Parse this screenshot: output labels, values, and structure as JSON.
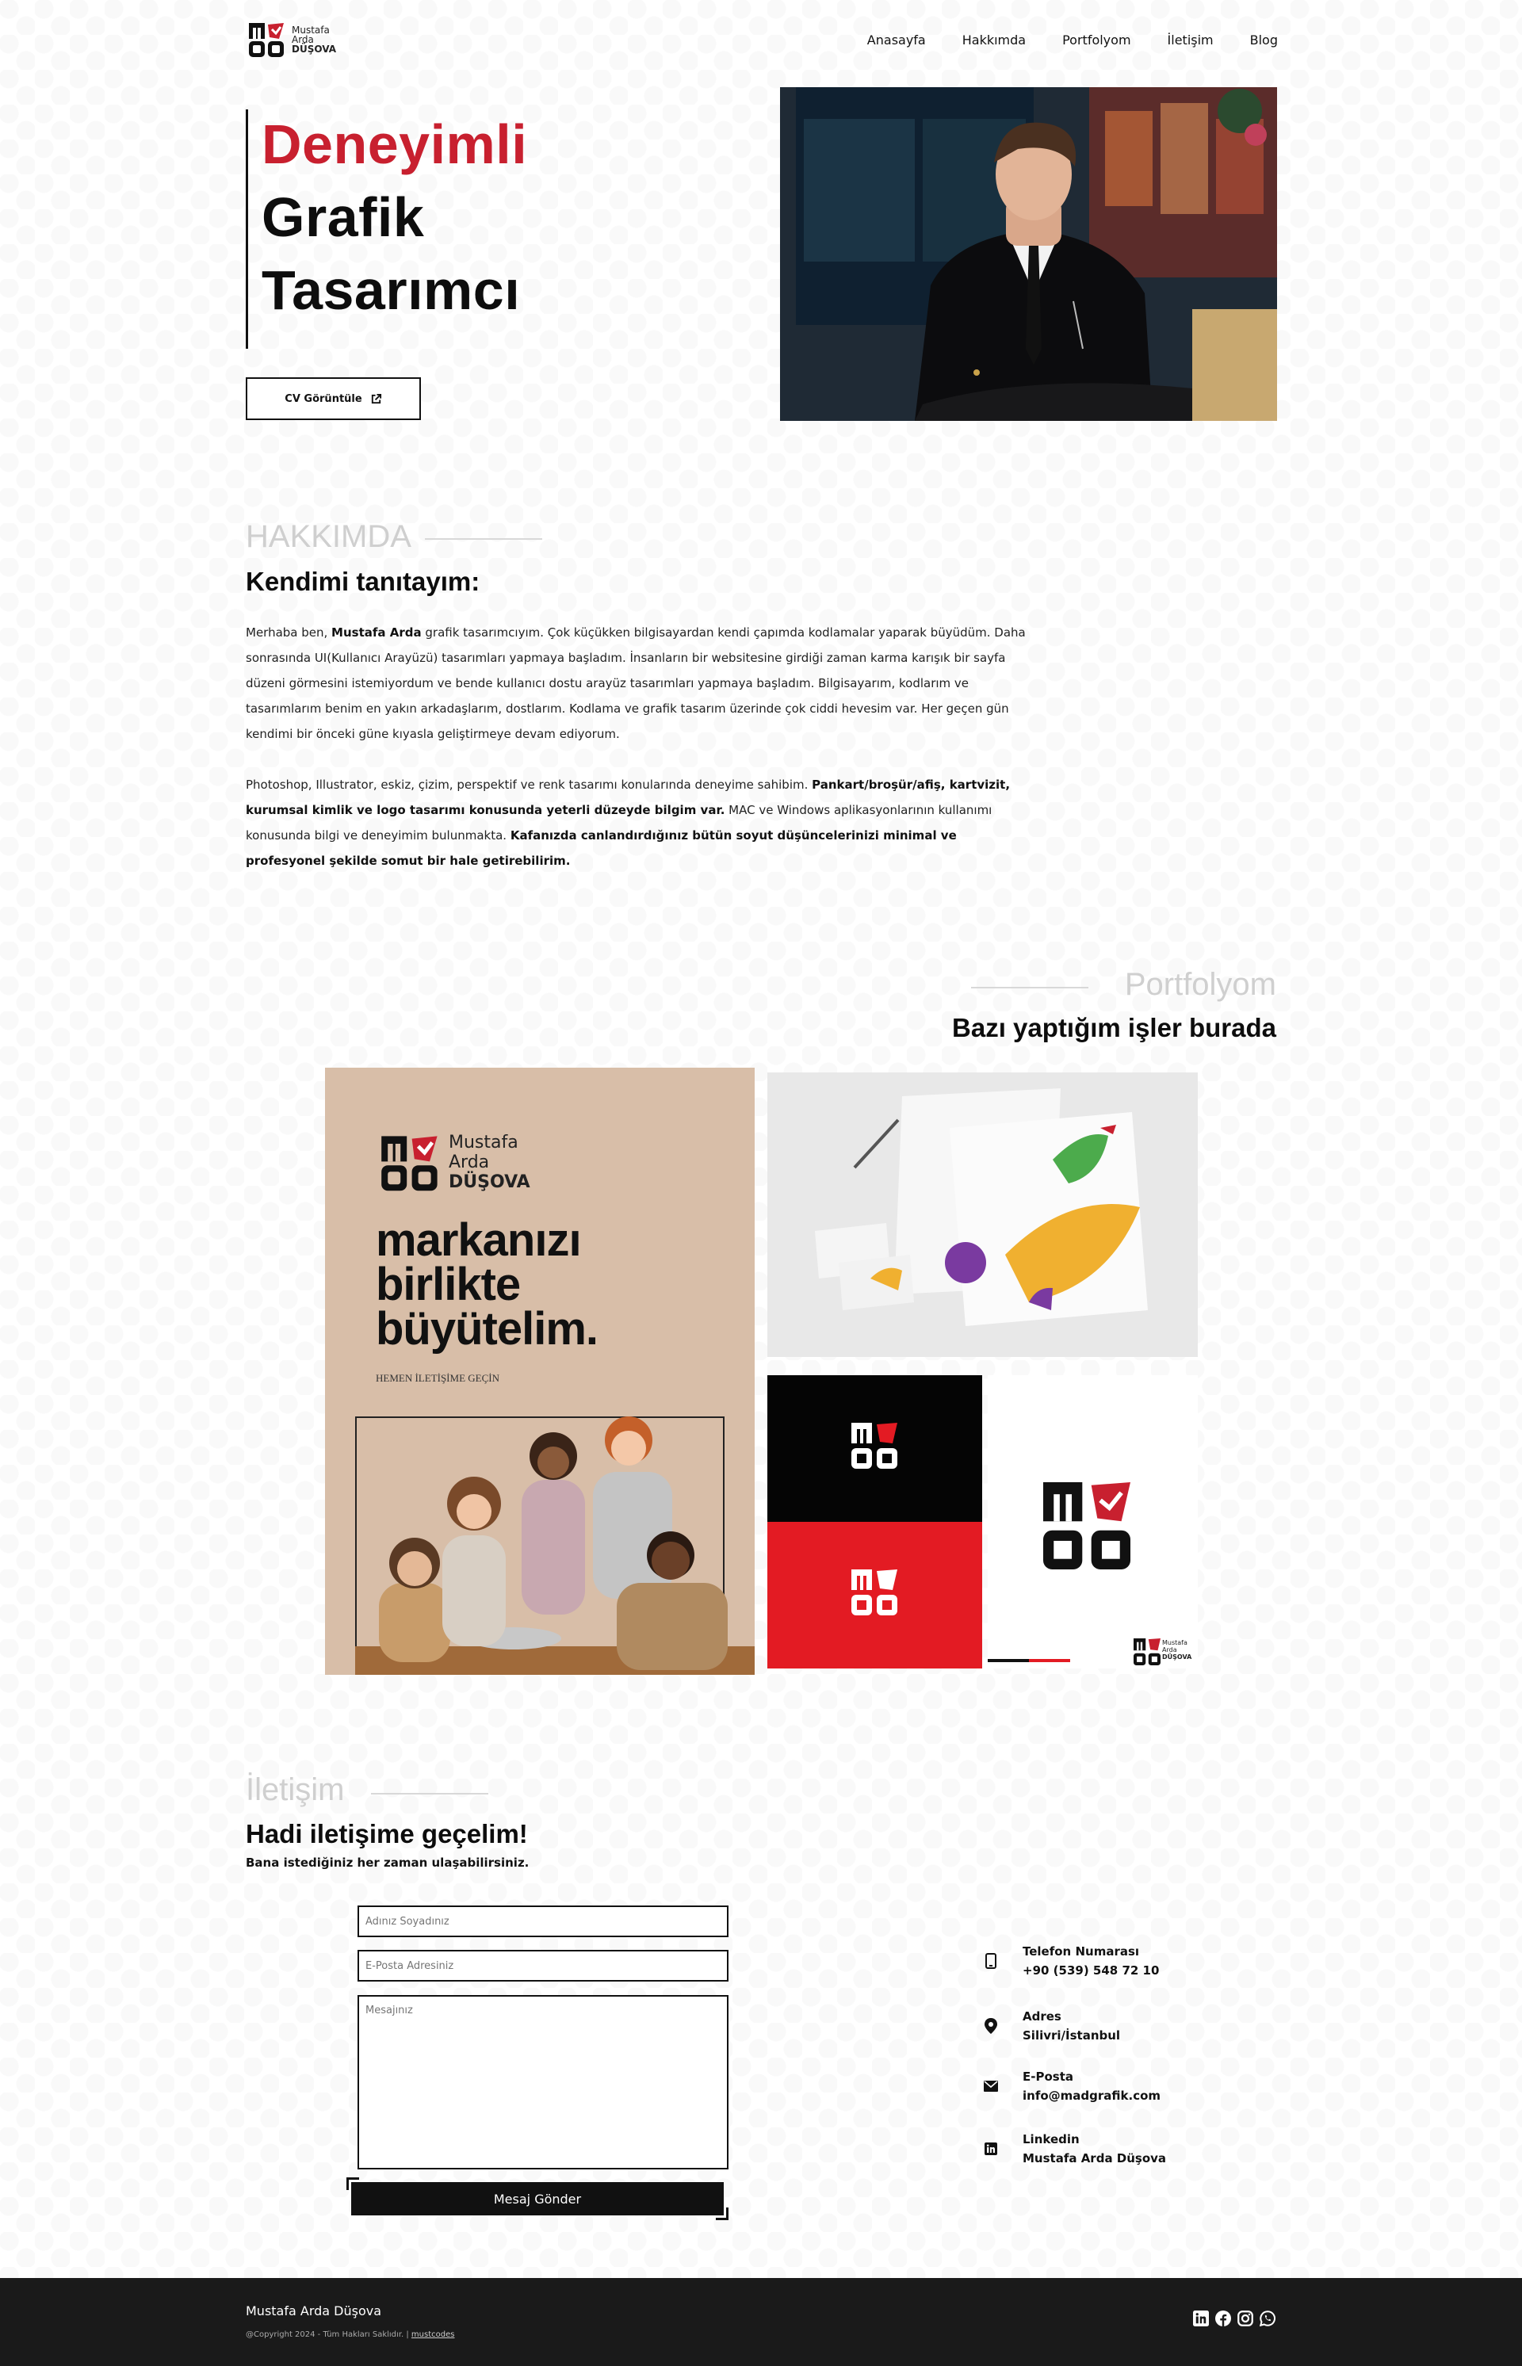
{
  "nav": {
    "brand_line1": "Mustafa",
    "brand_line2": "Arda",
    "brand_line3": "DÜŞOVA",
    "items": [
      "Anasayfa",
      "Hakkımda",
      "Portfolyom",
      "İletişim",
      "Blog"
    ]
  },
  "hero": {
    "title_line1": "Deneyimli",
    "title_line2": "Grafik",
    "title_line3": "Tasarımcı",
    "cv_button": "CV Görüntüle"
  },
  "about": {
    "kicker": "HAKKIMDA",
    "title": "Kendimi tanıtayım:",
    "p1_a": "Merhaba ben, ",
    "p1_name": "Mustafa Arda",
    "p1_b": " grafik tasarımcıyım. Çok küçükken bilgisayardan kendi çapımda kodlamalar yaparak büyüdüm. Daha sonrasında UI(Kullanıcı Arayüzü) tasarımları yapmaya başladım. İnsanların bir websitesine girdiği zaman karma karışık bir sayfa düzeni görmesini istemiyordum ve bende kullanıcı dostu arayüz tasarımları yapmaya başladım. Bilgisayarım, kodlarım ve tasarımlarım benim en yakın arkadaşlarım, dostlarım. Kodlama ve grafik tasarım üzerinde çok ciddi hevesim var. Her geçen gün kendimi bir önceki güne kıyasla geliştirmeye devam ediyorum.",
    "p2_a": "Photoshop, Illustrator, eskiz, çizim, perspektif ve renk tasarımı konularında deneyime sahibim. ",
    "p2_b": "Pankart/broşür/afiş, kartvizit, kurumsal kimlik ve logo tasarımı konusunda yeterli düzeyde bilgim var.",
    "p2_c": " MAC ve Windows aplikasyonlarının kullanımı konusunda bilgi ve deneyimim bulunmakta. ",
    "p2_d": "Kafanızda canlandırdığınız bütün soyut düşüncelerinizi minimal ve profesyonel şekilde somut bir hale getirebilirim."
  },
  "portfolio": {
    "kicker": "Portfolyom",
    "title": "Bazı yaptığım işler burada",
    "poster": {
      "brand_line1": "Mustafa",
      "brand_line2": "Arda",
      "brand_line3": "DÜŞOVA",
      "headline1": "markanızı",
      "headline2": "birlikte",
      "headline3": "büyütelim.",
      "sub": "HEMEN İLETİŞİME GEÇİN"
    },
    "mini_brand1": "Mustafa",
    "mini_brand2": "Arda",
    "mini_brand3": "DÜŞOVA"
  },
  "contact": {
    "kicker": "İletişim",
    "title": "Hadi iletişime geçelim!",
    "subtitle": "Bana istediğiniz her zaman ulaşabilirsiniz.",
    "name_placeholder": "Adınız Soyadınız",
    "email_placeholder": "E-Posta Adresiniz",
    "message_placeholder": "Mesajınız",
    "send_button": "Mesaj Gönder",
    "info": [
      {
        "icon": "phone-icon",
        "label": "Telefon Numarası",
        "value": "+90 (539) 548 72 10"
      },
      {
        "icon": "location-icon",
        "label": "Adres",
        "value": "Silivri/İstanbul"
      },
      {
        "icon": "mail-icon",
        "label": "E-Posta",
        "value": "info@madgrafik.com"
      },
      {
        "icon": "linkedin-icon",
        "label": "Linkedin",
        "value": "Mustafa Arda Düşova"
      }
    ]
  },
  "footer": {
    "name": "Mustafa Arda Düşova",
    "copyright": "@Copyright 2024 - Tüm Hakları Saklıdır. | ",
    "link": "mustcodes"
  },
  "colors": {
    "accent_red": "#c8202f",
    "dark": "#111111",
    "footer_bg": "#1a1a1a"
  }
}
